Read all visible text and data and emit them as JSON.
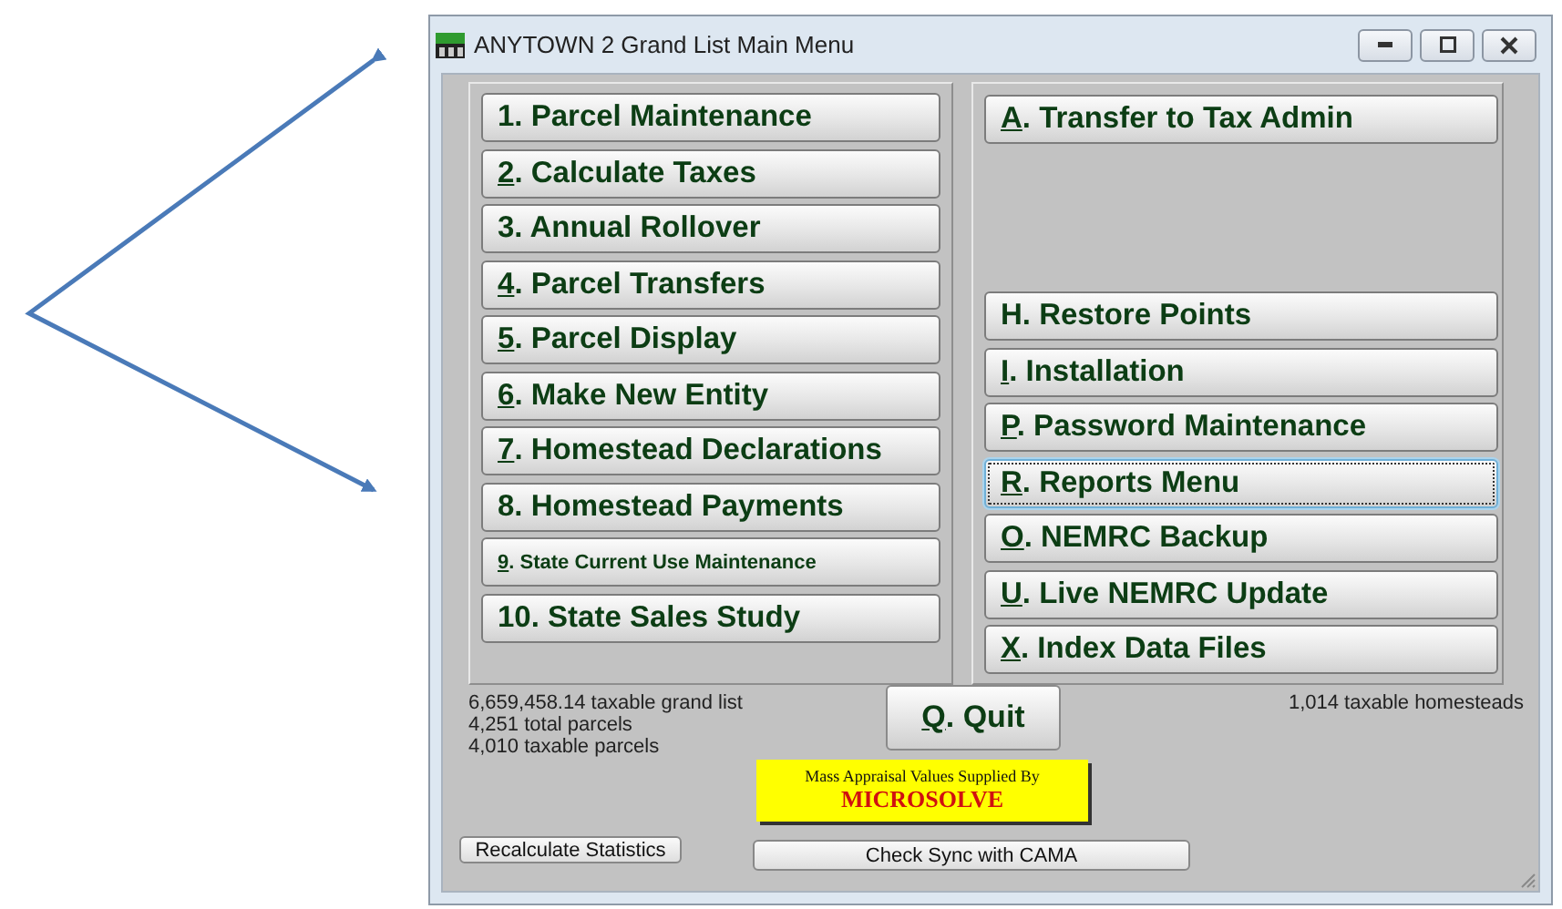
{
  "window": {
    "title": "ANYTOWN 2 Grand List Main Menu"
  },
  "left_menu": [
    {
      "label": "1.  Parcel Maintenance",
      "underline_key": false,
      "focused": false,
      "kind": "standard"
    },
    {
      "label": "2.  Calculate Taxes",
      "underline_key": true,
      "focused": false,
      "kind": "standard"
    },
    {
      "label": "3.  Annual Rollover",
      "underline_key": false,
      "focused": false,
      "kind": "standard"
    },
    {
      "label": "4.  Parcel Transfers",
      "underline_key": true,
      "focused": false,
      "kind": "standard"
    },
    {
      "label": "5.  Parcel Display",
      "underline_key": true,
      "focused": false,
      "kind": "standard"
    },
    {
      "label": "6. Make New Entity",
      "underline_key": true,
      "focused": false,
      "kind": "standard"
    },
    {
      "label": "7. Homestead Declarations",
      "underline_key": true,
      "focused": false,
      "kind": "standard"
    },
    {
      "label": "8. Homestead Payments",
      "underline_key": false,
      "focused": false,
      "kind": "standard"
    },
    {
      "label": "9. State Current Use Maintenance",
      "underline_key": true,
      "focused": false,
      "kind": "compact"
    },
    {
      "label": "10. State Sales Study",
      "underline_key": false,
      "focused": false,
      "kind": "standard"
    }
  ],
  "right_menu_top": [
    {
      "label": "A. Transfer to Tax Admin",
      "underline_key": true,
      "focused": false
    }
  ],
  "right_menu": [
    {
      "label": "H. Restore Points",
      "underline_key": false,
      "focused": false
    },
    {
      "label": "I.  Installation",
      "underline_key": true,
      "focused": false
    },
    {
      "label": "P.  Password Maintenance",
      "underline_key": true,
      "focused": false
    },
    {
      "label": "R.  Reports Menu",
      "underline_key": true,
      "focused": true
    },
    {
      "label": "O. NEMRC Backup",
      "underline_key": true,
      "focused": false
    },
    {
      "label": "U. Live NEMRC Update",
      "underline_key": true,
      "focused": false
    },
    {
      "label": "X.  Index Data Files",
      "underline_key": true,
      "focused": false
    }
  ],
  "stats": [
    "6,659,458.14 taxable grand list",
    "4,251 total parcels",
    "4,010 taxable parcels"
  ],
  "homesteads": "1,014 taxable homesteads",
  "quit_button": {
    "label": "Q.  Quit",
    "underline_key": true
  },
  "banner": {
    "line_1": "Mass Appraisal Values Supplied By",
    "line_2": "MICROSOLVE"
  },
  "recalculate_button": "Recalculate Statistics",
  "sync_button": "Check Sync with CAMA"
}
